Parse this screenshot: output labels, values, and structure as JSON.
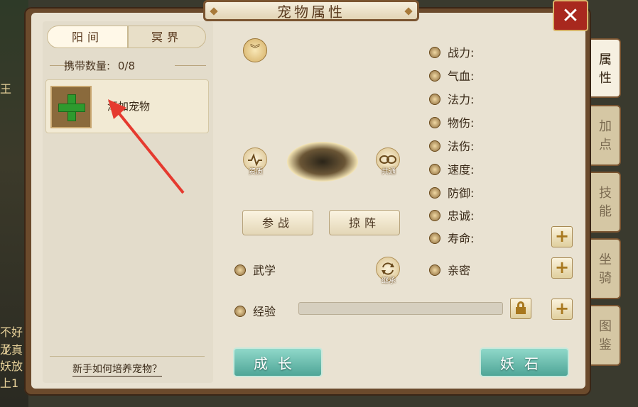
{
  "window": {
    "title": "宠物属性",
    "close_label": "✕"
  },
  "left": {
    "tabs": [
      {
        "label": "阳间",
        "active": true
      },
      {
        "label": "冥界",
        "active": false
      }
    ],
    "carry_label": "携带数量:",
    "carry_value": "0/8",
    "add_pet_label": "添加宠物",
    "guide_link": "新手如何培养宠物？"
  },
  "center": {
    "icons": {
      "left_label": "资质",
      "right_label": "共通",
      "inherit_label": "继承"
    },
    "battle_button": "参战",
    "formation_button": "掠阵",
    "martial_label": "武学",
    "exp_label": "经验",
    "exp_progress": 0,
    "intimacy_label": "亲密"
  },
  "stats": [
    {
      "label": "战力:",
      "icon": "power-icon"
    },
    {
      "label": "气血:",
      "icon": "heart-icon"
    },
    {
      "label": "法力:",
      "icon": "drop-icon"
    },
    {
      "label": "物伤:",
      "icon": "sword-icon"
    },
    {
      "label": "法伤:",
      "icon": "flame-icon"
    },
    {
      "label": "速度:",
      "icon": "speed-icon"
    },
    {
      "label": "防御:",
      "icon": "shield-icon"
    },
    {
      "label": "忠诚:",
      "icon": "loyalty-icon"
    },
    {
      "label": "寿命:",
      "icon": "life-icon"
    }
  ],
  "bottom": {
    "grow_button": "成长",
    "stone_button": "妖石"
  },
  "side_tabs": [
    {
      "label": "属性",
      "active": true
    },
    {
      "label": "加点",
      "active": false
    },
    {
      "label": "技能",
      "active": false
    },
    {
      "label": "坐骑",
      "active": false
    },
    {
      "label": "图鉴",
      "active": false
    }
  ],
  "background_text": [
    "王",
    "不好了",
    "龙真",
    "妖放",
    "上1"
  ],
  "colors": {
    "accent_green": "#2e9a2e",
    "teal_button": "#4fa597",
    "close_red": "#a8281e",
    "arrow_red": "#e53a2f"
  }
}
